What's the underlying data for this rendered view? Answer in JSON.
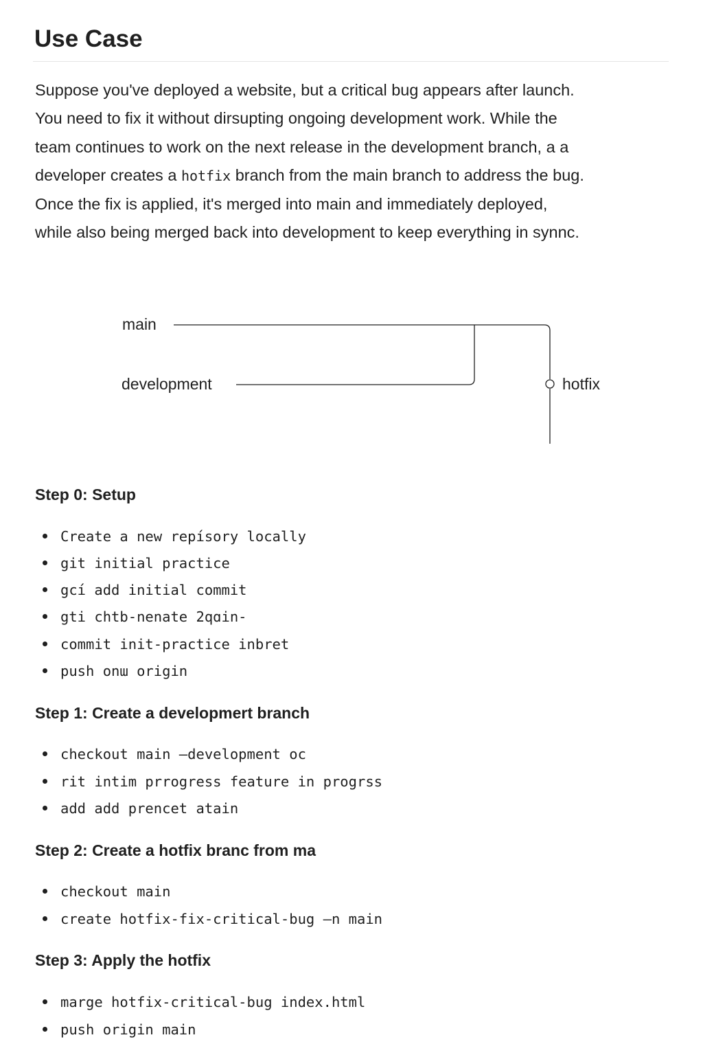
{
  "title": "Use Case",
  "paragraph_lines": [
    "Suppose you've deployed a website, but a critical bug appears after launch.",
    "You need to fix it without dirsupting ongoing development work. While the",
    "team continues to work on the next release in the development branch, a a",
    [
      "developer creates a ",
      "hotfix",
      " branch from the main branch to address the bug."
    ],
    "Once the fix is applied, it's merged into main and immediately deployed,",
    "while also being merged back into development to keep everything in synnc."
  ],
  "diagram": {
    "main_label": "main",
    "development_label": "development",
    "hotfix_label": "hotfix"
  },
  "steps": [
    {
      "heading": "Step 0: Setup",
      "items": [
        "Create a new repísory locally",
        "git initial practice",
        "gcí add initial commit",
        "gti chtb-nenate 2qɑin-",
        "commit init-practice inbret",
        "push onɯ origin"
      ]
    },
    {
      "heading": "Step 1: Create a developmert branch",
      "items": [
        "checkout main —development oc",
        "rit intim prrogress feature in progrss",
        "add add prencet atain"
      ]
    },
    {
      "heading": "Step 2: Create a hotfix branc from ma",
      "items": [
        "checkout main",
        "create hotfix-fix-critical-bug —n main"
      ]
    },
    {
      "heading": "Step 3: Apply the hotfix",
      "items": [
        "marge hotfix-critical-bug index.html",
        "push origin main"
      ]
    }
  ]
}
